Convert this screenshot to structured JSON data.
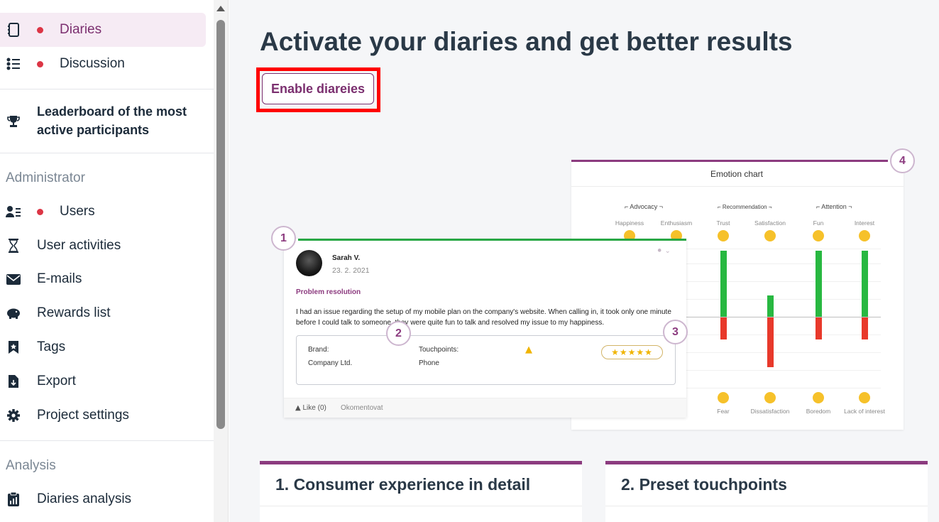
{
  "sidebar": {
    "items": [
      {
        "label": "Diaries",
        "icon": "notebook-icon",
        "dot": true,
        "active": true
      },
      {
        "label": "Discussion",
        "icon": "list-icon",
        "dot": true
      },
      {
        "label": "Leaderboard of the most",
        "label2": "active participants",
        "icon": "trophy-icon"
      },
      {
        "label": "Users",
        "icon": "users-icon",
        "dot": true
      },
      {
        "label": "User activities",
        "icon": "hourglass-icon"
      },
      {
        "label": "E-mails",
        "icon": "envelope-icon"
      },
      {
        "label": "Rewards list",
        "icon": "piggy-bank-icon"
      },
      {
        "label": "Tags",
        "icon": "bookmark-icon"
      },
      {
        "label": "Export",
        "icon": "file-download-icon"
      },
      {
        "label": "Project settings",
        "icon": "gear-icon"
      },
      {
        "label": "Diaries analysis",
        "icon": "clipboard-chart-icon"
      }
    ],
    "section_admin": "Administrator",
    "section_analysis": "Analysis"
  },
  "main": {
    "title": "Activate your diaries and get better results",
    "enable_button": "Enable diareies",
    "callouts": [
      "1",
      "2",
      "3",
      "4"
    ],
    "feature_cards": [
      "1. Consumer experience in detail",
      "2. Preset touchpoints"
    ]
  },
  "emotion_chart": {
    "title": "Emotion chart",
    "groups": [
      "⌐ Advocacy ¬",
      "⌐ Recommendation ¬",
      "⌐ Attention ¬"
    ],
    "positive": [
      {
        "label": "Happiness",
        "emoji": "😀",
        "value": 0
      },
      {
        "label": "Enthusiasm",
        "emoji": "😍",
        "value": 0
      },
      {
        "label": "Trust",
        "emoji": "🤝",
        "value": 93
      },
      {
        "label": "Satisfaction",
        "emoji": "👍",
        "value": 30
      },
      {
        "label": "Fun",
        "emoji": "😂",
        "value": 93
      },
      {
        "label": "Interest",
        "emoji": "🤔",
        "value": 93
      }
    ],
    "negative": [
      {
        "label": "Fear",
        "emoji": "😨",
        "value": 31
      },
      {
        "label": "Dissatisfaction",
        "emoji": "👎",
        "value": 70
      },
      {
        "label": "Boredom",
        "emoji": "😴",
        "value": 31
      },
      {
        "label": "Lack of interest",
        "emoji": "😐",
        "value": 31
      }
    ],
    "colors": {
      "positive": "#28b841",
      "negative": "#e8392b"
    }
  },
  "diary": {
    "author": "Sarah V.",
    "date": "23. 2. 2021",
    "topic": "Problem resolution",
    "text": "I had an issue regarding the setup of my mobile plan on the company's website. When calling in, it took only one minute before I could talk to someone. they were quite fun to talk and resolved my issue to my happiness.",
    "brand_label": "Brand:",
    "brand_value": "Company Ltd.",
    "touchpoints_label": "Touchpoints:",
    "touchpoints_value": "Phone",
    "rating_stars": 5,
    "stars_text": "★★★★★",
    "like": "Like (0)",
    "comment": "Okomentovat"
  },
  "colors": {
    "accent": "#7b2f6f",
    "alert": "#ff0000",
    "dot": "#dc3545"
  }
}
